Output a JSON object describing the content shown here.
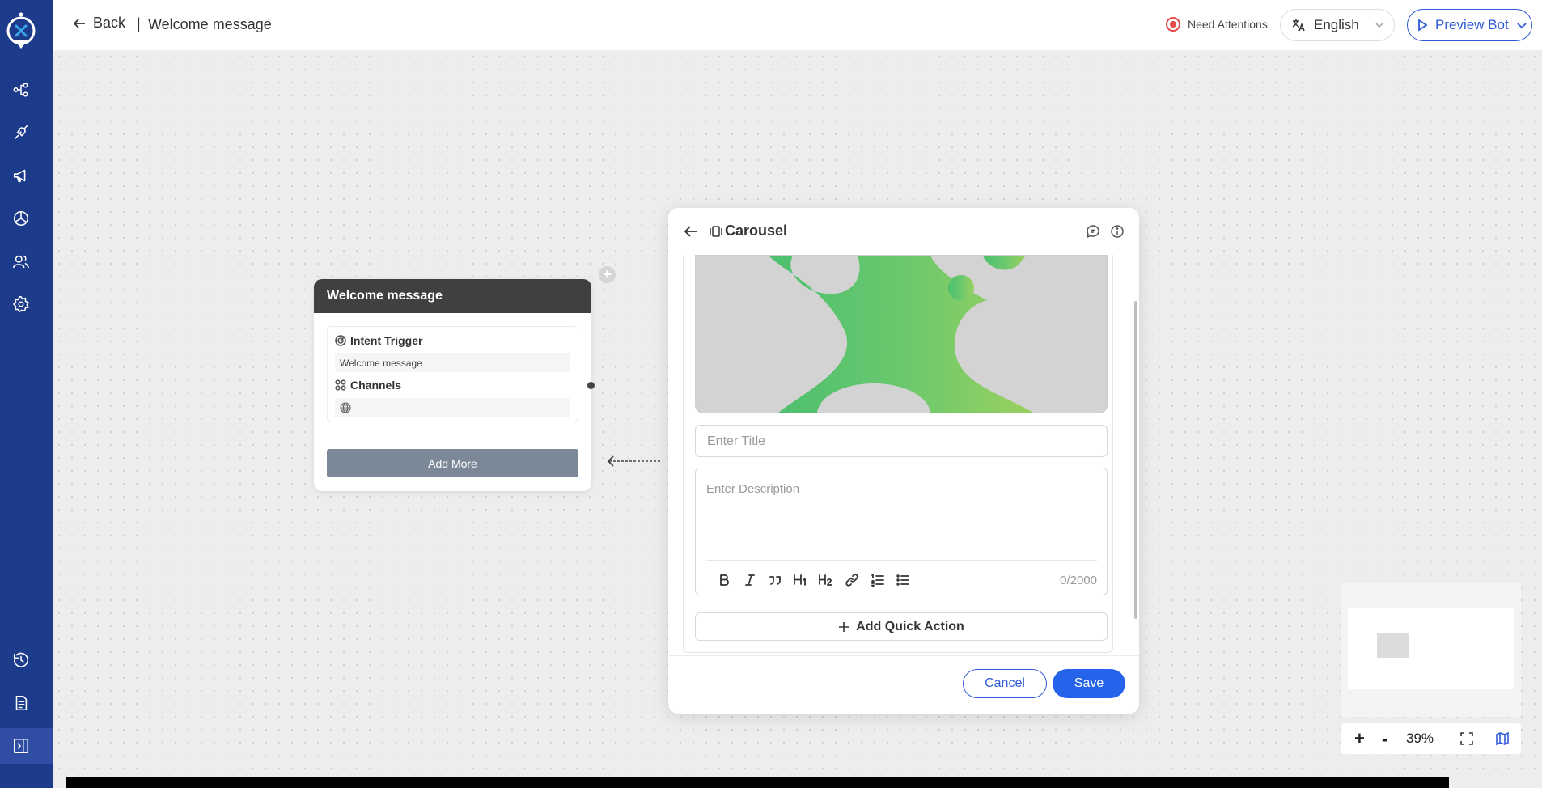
{
  "header": {
    "back_label": "Back",
    "separator": "|",
    "page_title": "Welcome message",
    "attention_label": "Need Attentions",
    "language_selected": "English",
    "preview_label": "Preview Bot"
  },
  "node": {
    "title": "Welcome message",
    "intent_label": "Intent Trigger",
    "intent_value": "Welcome message",
    "channels_label": "Channels",
    "add_more_label": "Add More"
  },
  "panel": {
    "title": "Carousel",
    "title_placeholder": "Enter Title",
    "description_placeholder": "Enter Description",
    "char_count": "0/2000",
    "quick_action_label": "Add Quick Action",
    "cancel_label": "Cancel",
    "save_label": "Save"
  },
  "zoom": {
    "plus": "+",
    "minus": "-",
    "level": "39%"
  },
  "colors": {
    "sidebar": "#1d3b8b",
    "accent": "#2563eb",
    "node_header": "#404040",
    "add_more": "#7a8898"
  }
}
